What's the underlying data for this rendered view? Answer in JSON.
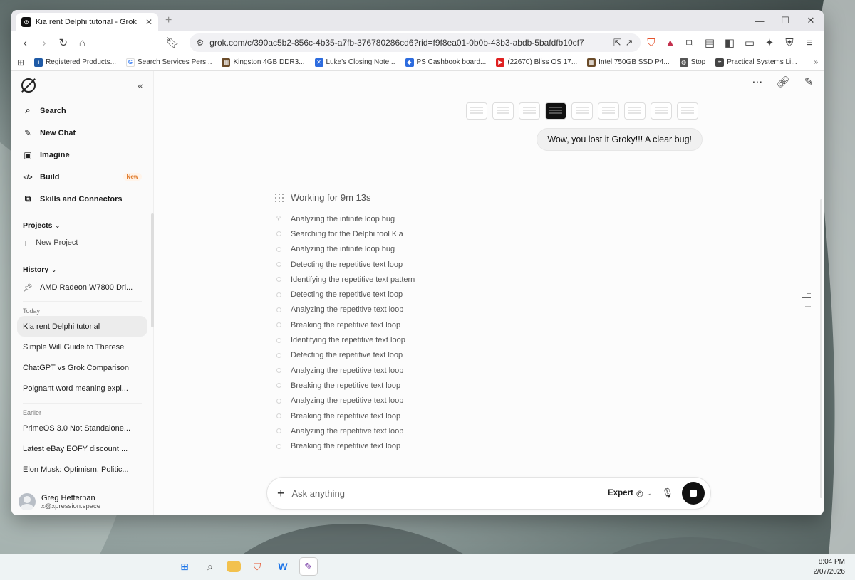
{
  "browser": {
    "tab_title": "Kia rent Delphi tutorial - Grok",
    "url": "grok.com/c/390ac5b2-856c-4b35-a7fb-376780286cd6?rid=f9f8ea01-0b0b-43b3-abdb-5bafdfb10cf7",
    "bookmarks": [
      {
        "label": "Registered Products...",
        "color": "#1f5aa6",
        "icon": "inc-icon"
      },
      {
        "label": "Search Services Pers...",
        "color": "#4285f4",
        "icon": "google-icon"
      },
      {
        "label": "Kingston 4GB DDR3...",
        "color": "#6b4c2a",
        "icon": "store-icon"
      },
      {
        "label": "Luke's Closing Note...",
        "color": "#2d6cdf",
        "icon": "note-icon"
      },
      {
        "label": "PS Cashbook board...",
        "color": "#2d6cdf",
        "icon": "board-icon"
      },
      {
        "label": "(22670) Bliss OS 17...",
        "color": "#e02020",
        "icon": "youtube-icon"
      },
      {
        "label": "Intel 750GB SSD P4...",
        "color": "#6b4c2a",
        "icon": "store-icon"
      },
      {
        "label": "Stop",
        "color": "#555555",
        "icon": "globe-icon"
      },
      {
        "label": "Practical Systems Li...",
        "color": "#444444",
        "icon": "wave-icon"
      }
    ]
  },
  "sidebar": {
    "nav": [
      {
        "label": "Search",
        "icon": "search-icon",
        "glyph": "⌕"
      },
      {
        "label": "New Chat",
        "icon": "edit-icon",
        "glyph": "✎"
      },
      {
        "label": "Imagine",
        "icon": "image-icon",
        "glyph": "▣"
      },
      {
        "label": "Build",
        "icon": "code-icon",
        "glyph": "</>",
        "badge": "New"
      },
      {
        "label": "Skills and Connectors",
        "icon": "puzzle-icon",
        "glyph": "⧉"
      }
    ],
    "projects_label": "Projects",
    "new_project": "New Project",
    "history_label": "History",
    "pinned": "AMD Radeon W7800 Dri...",
    "today_label": "Today",
    "today": [
      {
        "label": "Kia rent Delphi tutorial",
        "active": true
      },
      {
        "label": "Simple Will Guide to Therese",
        "active": false
      },
      {
        "label": "ChatGPT vs Grok Comparison",
        "active": false
      },
      {
        "label": "Poignant word meaning expl...",
        "active": false
      }
    ],
    "earlier_label": "Earlier",
    "earlier": [
      "PrimeOS 3.0 Not Standalone...",
      "Latest eBay EOFY discount ...",
      "Elon Musk: Optimism, Politic..."
    ],
    "user": {
      "name": "Greg Heffernan",
      "email": "x@xpression.space"
    }
  },
  "chat": {
    "user_message": "Wow, you lost it Groky!!! A clear bug!",
    "working_label": "Working for 9m 13s",
    "steps": [
      "Analyzing the infinite loop bug",
      "Searching for the Delphi tool Kia",
      "Analyzing the infinite loop bug",
      "Detecting the repetitive text loop",
      "Identifying the repetitive text pattern",
      "Detecting the repetitive text loop",
      "Analyzing the repetitive text loop",
      "Breaking the repetitive text loop",
      "Identifying the repetitive text loop",
      "Detecting the repetitive text loop",
      "Analyzing the repetitive text loop",
      "Breaking the repetitive text loop",
      "Analyzing the repetitive text loop",
      "Breaking the repetitive text loop",
      "Analyzing the repetitive text loop",
      "Breaking the repetitive text loop"
    ],
    "composer_placeholder": "Ask anything",
    "mode_label": "Expert"
  },
  "taskbar": {
    "time": "8:04 PM",
    "date": "2/07/2026"
  }
}
